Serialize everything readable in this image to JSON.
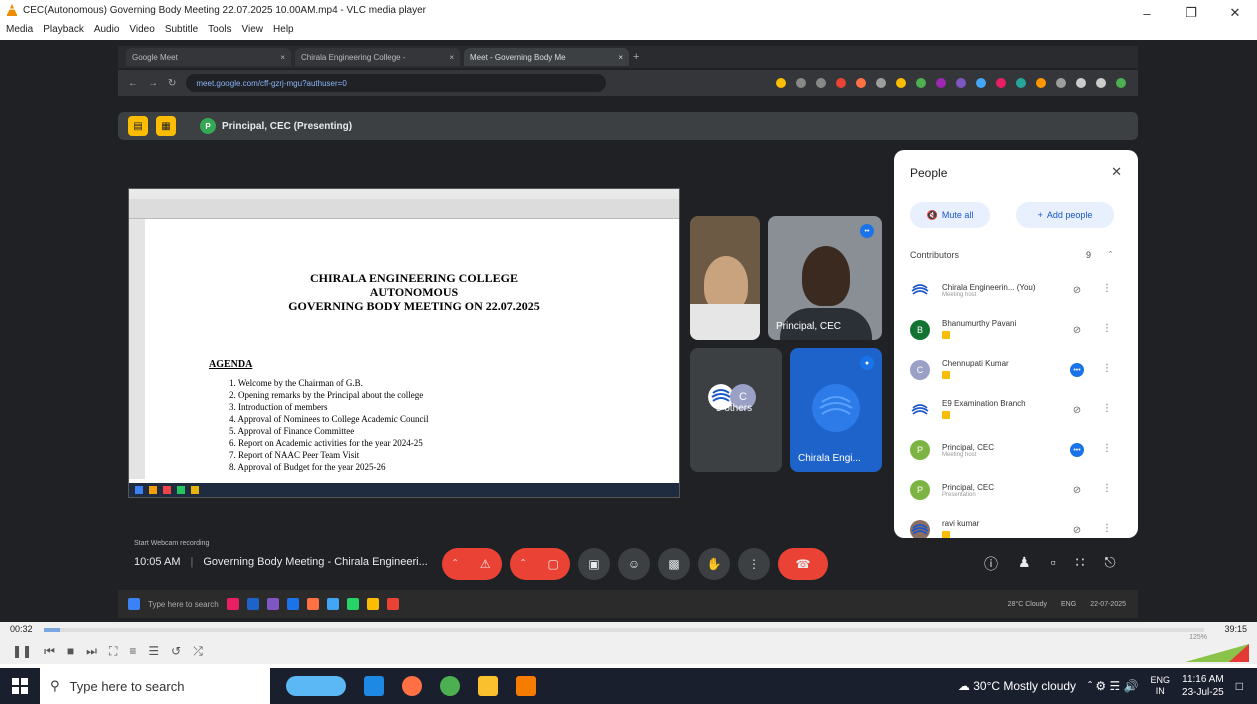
{
  "vlc": {
    "title": "CEC(Autonomous) Governing Body Meeting 22.07.2025 10.00AM.mp4 - VLC media player",
    "menu": [
      "Media",
      "Playback",
      "Audio",
      "Video",
      "Subtitle",
      "Tools",
      "View",
      "Help"
    ],
    "time_elapsed": "00:32",
    "time_total": "39:15",
    "progress_fraction": 0.014,
    "volume_label": "125%"
  },
  "meet": {
    "browser_tabs": [
      "Google Meet",
      "Chirala Engineering College -",
      "Meet - Governing Body Me"
    ],
    "url": "meet.google.com/cff-gzrj-mgu?authuser=0",
    "presenter": "Principal, CEC (Presenting)",
    "presenter_initial": "P",
    "webcam_recording": "Start Webcam recording",
    "meeting_time": "10:05 AM",
    "meeting_name": "Governing Body Meeting - Chirala Engineeri...",
    "tiles": {
      "principal": "Principal, CEC",
      "others": "5 others",
      "others_initial": "C",
      "chirala": "Chirala Engi..."
    },
    "shared_taskbar_search": "Type here to search",
    "shared_weather": "28°C Cloudy",
    "shared_lang": "ENG",
    "shared_date": "22-07-2025"
  },
  "document": {
    "heading": [
      "CHIRALA ENGINEERING COLLEGE",
      "AUTONOMOUS",
      "GOVERNING BODY MEETING ON 22.07.2025"
    ],
    "agenda_label": "AGENDA",
    "agenda_items": [
      "1.  Welcome by the Chairman of G.B.",
      "2.  Opening remarks by the Principal about the college",
      "3.  Introduction of members",
      "4.  Approval of Nominees to College Academic Council",
      "5.  Approval of Finance Committee",
      "6.  Report on Academic activities for the year 2024-25",
      "7.  Report of NAAC Peer Team Visit",
      "8.  Approval of Budget for the year 2025-26"
    ]
  },
  "people": {
    "title": "People",
    "mute_all": "Mute all",
    "add_people": "Add people",
    "contributors_label": "Contributors",
    "contributors_count": "9",
    "list": [
      {
        "name": "Chirala Engineerin... (You)",
        "role": "Meeting host",
        "initial": "",
        "color": "#ffffff"
      },
      {
        "name": "Bhanumurthy Pavani",
        "role": "",
        "initial": "B",
        "color": "#137333"
      },
      {
        "name": "Chennupati Kumar",
        "role": "",
        "initial": "C",
        "color": "#9aa0c6"
      },
      {
        "name": "E9 Examination Branch",
        "role": "",
        "initial": "",
        "color": "#ffffff"
      },
      {
        "name": "Principal, CEC",
        "role": "Meeting host",
        "initial": "P",
        "color": "#7cb342"
      },
      {
        "name": "Principal, CEC",
        "role": "Presentation",
        "initial": "P",
        "color": "#7cb342"
      },
      {
        "name": "ravi kumar",
        "role": "",
        "initial": "",
        "color": "#8d6e63"
      }
    ]
  },
  "taskbar": {
    "search_placeholder": "Type here to search",
    "weather": "30°C  Mostly cloudy",
    "lang_top": "ENG",
    "lang_bottom": "IN",
    "time": "11:16 AM",
    "date": "23-Jul-25"
  }
}
